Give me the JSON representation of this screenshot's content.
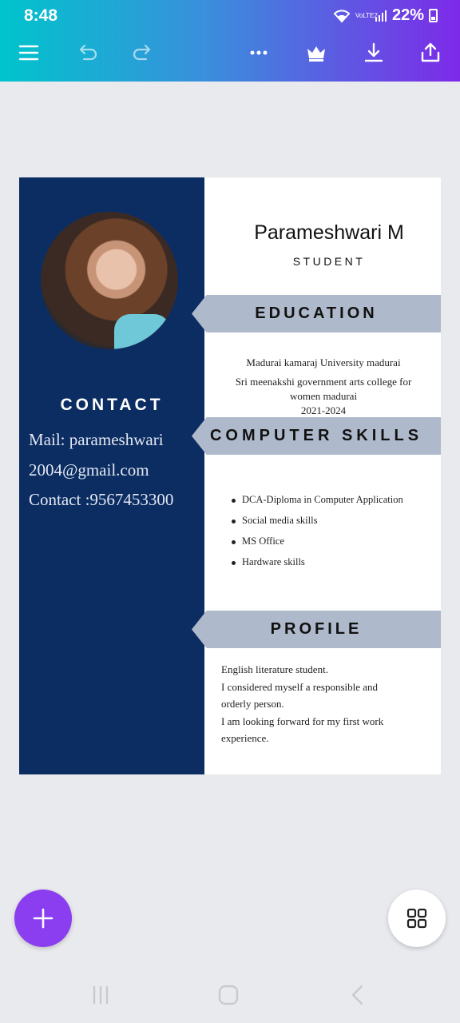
{
  "status_bar": {
    "time": "8:48",
    "network_label": "VoLTE2",
    "battery": "22%"
  },
  "toolbar": {
    "icons": [
      "menu-icon",
      "undo-icon",
      "redo-icon",
      "more-icon",
      "crown-icon",
      "download-icon",
      "share-icon"
    ]
  },
  "resume": {
    "name": "Parameshwari M",
    "subtitle": "STUDENT",
    "contact": {
      "title": "CONTACT",
      "lines": [
        "Mail: parameshwari",
        "2004@gmail.com",
        "Contact :9567453300"
      ]
    },
    "education": {
      "title": "EDUCATION",
      "lines": [
        "Madurai kamaraj University madurai",
        "Sri meenakshi government arts college for",
        "women madurai",
        "2021-2024"
      ]
    },
    "skills": {
      "title": "COMPUTER SKILLS",
      "items": [
        "DCA-Diploma in Computer Application",
        "Social media skills",
        "MS Office",
        "Hardware skills"
      ]
    },
    "profile": {
      "title": "PROFILE",
      "lines": [
        "English literature student.",
        "I considered myself a responsible and",
        "orderly person.",
        "I am looking forward for my first work",
        "experience."
      ]
    }
  },
  "colors": {
    "sidebar": "#0b2d62",
    "banner": "#aebacb",
    "fab": "#8b3df0"
  }
}
